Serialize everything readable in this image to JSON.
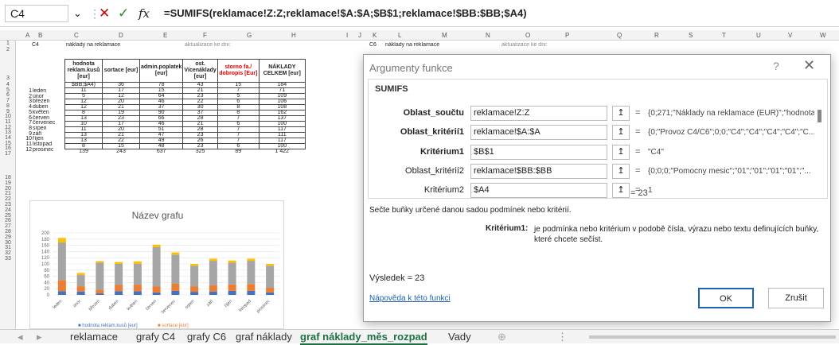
{
  "formula_bar": {
    "name_box": "C4",
    "dropdown_icon": "chevron-down-icon",
    "more_icon": "⋮",
    "cancel_icon": "✕",
    "enter_icon": "✓",
    "fx_label": "fx",
    "formula": "=SUMIFS(reklamace!Z:Z;reklamace!$A:$A;$B$1;reklamace!$BB:$BB;$A4)"
  },
  "columns": [
    "A",
    "B",
    "C",
    "D",
    "E",
    "F",
    "G",
    "H",
    "I",
    "J",
    "K",
    "L",
    "M",
    "N",
    "O",
    "P",
    "Q",
    "R",
    "S",
    "T",
    "U",
    "V",
    "W"
  ],
  "rows": [
    "1",
    "2",
    "3",
    "4",
    "5",
    "6",
    "7",
    "8",
    "9",
    "10",
    "11",
    "12",
    "13",
    "14",
    "15",
    "16",
    "17",
    "18",
    "19",
    "20",
    "21",
    "22",
    "23",
    "24",
    "25",
    "26",
    "27",
    "28",
    "29",
    "30",
    "31",
    "32",
    "33"
  ],
  "sheet_left": {
    "b1": "C4",
    "c1": "náklady na reklamace",
    "e1": "aktualizace ke dni:"
  },
  "sheet_right": {
    "k1": "C6",
    "l1": "náklady na reklamace",
    "o1": "aktualizace ke dni:"
  },
  "table": {
    "headers": [
      "hodnota reklam.kusů [eur]",
      "sortace [eur]",
      "admin.poplatek [eur]",
      "ost. Vícenáklady [eur]",
      "storno fa./ dobropis [Eur]",
      "NÁKLADY CELKEM [eur]"
    ],
    "rows": [
      {
        "n": "1",
        "m": "leden",
        "c": "$BB;$A4)",
        "d": "36",
        "e": "78",
        "f": "43",
        "g": "15",
        "h": "184"
      },
      {
        "n": "2",
        "m": "únor",
        "c": "11",
        "d": "17",
        "e": "15",
        "f": "21",
        "g": "7",
        "h": "71"
      },
      {
        "n": "3",
        "m": "březen",
        "c": "5",
        "d": "12",
        "e": "64",
        "f": "23",
        "g": "5",
        "h": "109"
      },
      {
        "n": "4",
        "m": "duben",
        "c": "12",
        "d": "20",
        "e": "46",
        "f": "22",
        "g": "6",
        "h": "106"
      },
      {
        "n": "5",
        "m": "květen",
        "c": "12",
        "d": "21",
        "e": "37",
        "f": "30",
        "g": "8",
        "h": "108"
      },
      {
        "n": "6",
        "m": "červen",
        "c": "8",
        "d": "19",
        "e": "90",
        "f": "37",
        "g": "8",
        "h": "162"
      },
      {
        "n": "7",
        "m": "červenec",
        "c": "13",
        "d": "23",
        "e": "66",
        "f": "28",
        "g": "7",
        "h": "137"
      },
      {
        "n": "8",
        "m": "srpen",
        "c": "10",
        "d": "17",
        "e": "46",
        "f": "21",
        "g": "6",
        "h": "100"
      },
      {
        "n": "9",
        "m": "září",
        "c": "11",
        "d": "20",
        "e": "51",
        "f": "28",
        "g": "7",
        "h": "117"
      },
      {
        "n": "10",
        "m": "říjen",
        "c": "13",
        "d": "21",
        "e": "47",
        "f": "23",
        "g": "7",
        "h": "111"
      },
      {
        "n": "11",
        "m": "listopad",
        "c": "13",
        "d": "22",
        "e": "49",
        "f": "26",
        "g": "7",
        "h": "117"
      },
      {
        "n": "12",
        "m": "prosinec",
        "c": "8",
        "d": "15",
        "e": "48",
        "f": "23",
        "g": "6",
        "h": "100"
      }
    ],
    "totals": {
      "c": "139",
      "d": "243",
      "e": "637",
      "f": "325",
      "g": "89",
      "h": "1 422"
    }
  },
  "chart_data": {
    "type": "bar",
    "stacked": true,
    "title": "Název grafu",
    "categories": [
      "leden",
      "únor",
      "březen",
      "duben",
      "květen",
      "červen",
      "červenec",
      "srpen",
      "září",
      "říjen",
      "listopad",
      "prosinec"
    ],
    "ylim": [
      0,
      200
    ],
    "yticks": [
      "0",
      "20",
      "40",
      "60",
      "80",
      "100",
      "120",
      "140",
      "160",
      "180",
      "200"
    ],
    "series": [
      {
        "name": "hodnota reklam.kusů [eur]",
        "color": "#4472c4",
        "values": [
          12,
          11,
          5,
          12,
          12,
          8,
          13,
          10,
          11,
          13,
          13,
          8
        ]
      },
      {
        "name": "sortace [eur]",
        "color": "#ed7d31",
        "values": [
          36,
          17,
          12,
          20,
          21,
          19,
          23,
          17,
          20,
          21,
          22,
          15
        ]
      },
      {
        "name": "",
        "color": "#a5a5a5",
        "values": [
          121,
          36,
          87,
          68,
          67,
          127,
          94,
          67,
          79,
          70,
          75,
          71
        ]
      },
      {
        "name": "",
        "color": "#ffc000",
        "values": [
          15,
          7,
          5,
          6,
          8,
          8,
          7,
          6,
          7,
          7,
          7,
          6
        ]
      }
    ],
    "legend_position": "bottom",
    "legend_text": [
      "■ hodnota reklam.kusů [eur]",
      "■ sortace [eur]"
    ]
  },
  "dialog": {
    "title": "Argumenty funkce",
    "help_icon": "?",
    "close_icon": "✕",
    "function_name": "SUMIFS",
    "args": [
      {
        "label": "Oblast_součtu",
        "value": "reklamace!Z:Z",
        "result": "{0;271;\"Náklady na reklamace (EUR)\";\"hodnota"
      },
      {
        "label": "Oblast_kritérií1",
        "value": "reklamace!$A:$A",
        "result": "{0;\"Provoz C4/C6\";0;0;\"C4\";\"C4\";\"C4\";\"C4\";\"C..."
      },
      {
        "label": "Kritérium1",
        "value": "$B$1",
        "result": "\"C4\""
      },
      {
        "label": "Oblast_kritérií2",
        "value": "reklamace!$BB:$BB",
        "result": "{0;0;0;\"Pomocny mesic\";\"01\";\"01\";\"01\";\"01\";\"..."
      },
      {
        "label": "Kritérium2",
        "value": "$A4",
        "result": "1"
      }
    ],
    "ref_icon": "↥",
    "eq": "=",
    "formula_result": "= 23",
    "description": "Sečte buňky určené danou sadou podmínek nebo kritérií.",
    "crit_name": "Kritérium1:",
    "crit_desc": "je podmínka nebo kritérium v podobě čísla, výrazu nebo textu definujících buňky, které chcete sečíst.",
    "result_label": "Výsledek =  23",
    "help_link": "Nápověda k této funkci",
    "ok": "OK",
    "cancel": "Zrušit"
  },
  "tabs": {
    "prev": "◂",
    "next": "▸",
    "items": [
      "reklamace",
      "grafy C4",
      "grafy C6",
      "graf náklady",
      "graf náklady_měs_rozpad",
      "Vady"
    ],
    "add": "⊕",
    "more": "⋮"
  }
}
